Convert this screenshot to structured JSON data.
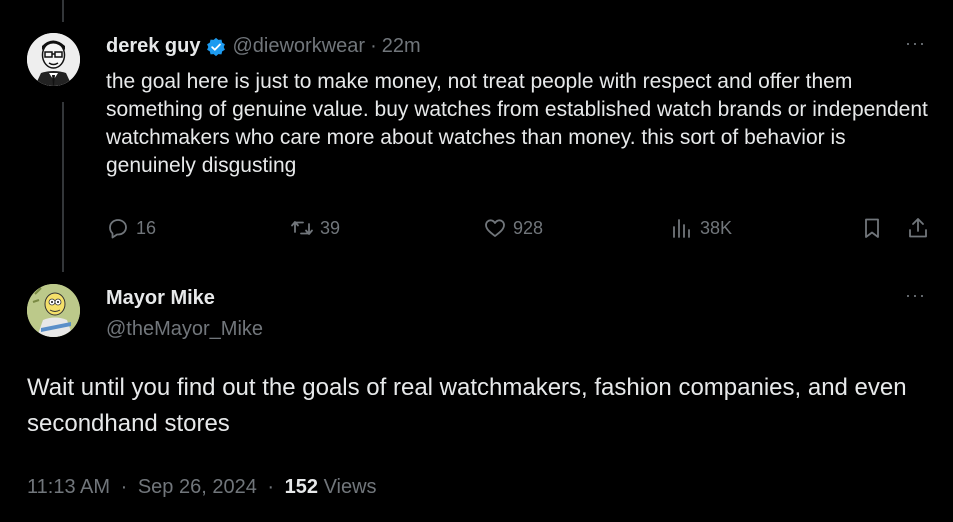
{
  "parent_tweet": {
    "display_name": "derek guy",
    "handle": "@dieworkwear",
    "time_ago": "22m",
    "text": "the goal here is just to make money, not treat people with respect and offer them something of genuine value. buy watches from established watch brands or independent watchmakers who care more about watches than money. this sort of behavior is genuinely disgusting",
    "replies": "16",
    "reposts": "39",
    "likes": "928",
    "views": "38K",
    "verified_color": "#1d9bf0"
  },
  "reply_tweet": {
    "display_name": "Mayor Mike",
    "handle": "@theMayor_Mike",
    "text": "Wait until you find out the goals of real watchmakers, fashion companies, and even secondhand stores",
    "time": "11:13 AM",
    "date": "Sep 26, 2024",
    "views_count": "152",
    "views_label": "Views"
  },
  "separator": "·",
  "more_label": "···",
  "icons": [
    "verified-badge-icon",
    "more-icon",
    "reply-icon",
    "repost-icon",
    "like-icon",
    "views-icon",
    "bookmark-icon",
    "share-icon"
  ],
  "colors": {
    "background": "#000000",
    "text": "#e7e9ea",
    "muted": "#71767b",
    "accent": "#1d9bf0"
  }
}
